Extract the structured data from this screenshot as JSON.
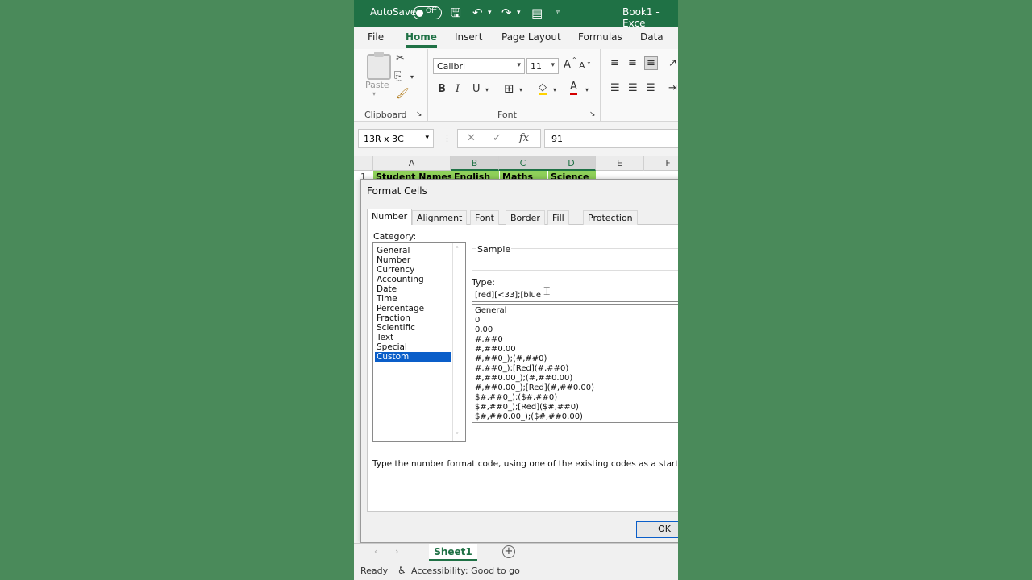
{
  "titlebar": {
    "autosave_label": "AutoSave",
    "autosave_state": "Off",
    "book_title": "Book1 - Exce"
  },
  "tabs": [
    {
      "label": "File"
    },
    {
      "label": "Home"
    },
    {
      "label": "Insert"
    },
    {
      "label": "Page Layout"
    },
    {
      "label": "Formulas"
    },
    {
      "label": "Data"
    }
  ],
  "active_tab": "Home",
  "ribbon": {
    "clipboard": {
      "paste_label": "Paste",
      "group_label": "Clipboard"
    },
    "font": {
      "font_name": "Calibri",
      "font_size": "11",
      "bold": "B",
      "italic": "I",
      "underline": "U",
      "grow": "A",
      "shrink": "A",
      "font_color": "A",
      "group_label": "Font"
    }
  },
  "formula_bar": {
    "name_box": "13R x 3C",
    "value": "91"
  },
  "columns": [
    {
      "label": ""
    },
    {
      "label": "A"
    },
    {
      "label": "B"
    },
    {
      "label": "C"
    },
    {
      "label": "D"
    },
    {
      "label": "E"
    },
    {
      "label": "F"
    }
  ],
  "row1": {
    "row_number": "1",
    "cells": [
      "Student Names",
      "English",
      "Maths",
      "Science"
    ]
  },
  "dialog": {
    "title": "Format Cells",
    "tabs": [
      "Number",
      "Alignment",
      "Font",
      "Border",
      "Fill",
      "Protection"
    ],
    "category_label": "Category:",
    "categories": [
      "General",
      "Number",
      "Currency",
      "Accounting",
      "Date",
      "Time",
      "Percentage",
      "Fraction",
      "Scientific",
      "Text",
      "Special",
      "Custom"
    ],
    "selected_category": "Custom",
    "sample_label": "Sample",
    "type_label": "Type:",
    "type_value": "[red][<33];[blue",
    "type_list": [
      "General",
      "0",
      "0.00",
      "#,##0",
      "#,##0.00",
      "#,##0_);(#,##0)",
      "#,##0_);[Red](#,##0)",
      "#,##0.00_);(#,##0.00)",
      "#,##0.00_);[Red](#,##0.00)",
      "$#,##0_);($#,##0)",
      "$#,##0_);[Red]($#,##0)",
      "$#,##0.00_);($#,##0.00)"
    ],
    "hint": "Type the number format code, using one of the existing codes as a starting poi",
    "ok_label": "OK"
  },
  "sheet_tabs": [
    {
      "label": "Sheet1"
    }
  ],
  "status": {
    "ready": "Ready",
    "accessibility": "Accessibility: Good to go"
  },
  "colors": {
    "excel_green": "#1f7145",
    "background": "#4a8a5a",
    "selection_blue": "#0a5ec9",
    "header_fill": "#8fd15a"
  }
}
